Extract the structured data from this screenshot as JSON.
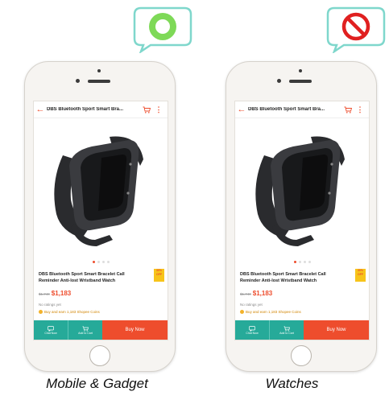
{
  "panels": [
    {
      "id": "left",
      "status": "allowed",
      "app_bar": {
        "title": "DBS Bluetooth Sport Smart Bra..."
      },
      "product": {
        "name": "DBS Bluetooth Sport Smart Bracelet Call Reminder Anti-lost Wristband Watch",
        "old_price": "$1,740",
        "price": "$1,183",
        "ratings": "No ratings yet",
        "coins": "Buy and earn 1,183 Shopee Coins",
        "badge": "30% OFF"
      },
      "actions": {
        "chat": "Chat Now",
        "cart": "Add to Cart",
        "buy": "Buy Now"
      },
      "caption": "Mobile & Gadget"
    },
    {
      "id": "right",
      "status": "prohibited",
      "app_bar": {
        "title": "DBS Bluetooth Sport Smart Bra..."
      },
      "product": {
        "name": "DBS Bluetooth Sport Smart Bracelet Call Reminder Anti-lost Wristband Watch",
        "old_price": "$1,740",
        "price": "$1,183",
        "ratings": "No ratings yet",
        "coins": "Buy and earn 1,183 Shopee Coins",
        "badge": "30% OFF"
      },
      "actions": {
        "chat": "Chat Now",
        "cart": "Add to Cart",
        "buy": "Buy Now"
      },
      "caption": "Watches"
    }
  ],
  "colors": {
    "brand": "#ee4d2d",
    "chat": "#26aa99",
    "ok": "#7ed957",
    "ok_ring": "#3fb949",
    "no": "#e02020",
    "bubble_border": "#7fd7cc"
  },
  "icons": [
    "green-circle-icon",
    "prohibited-icon",
    "back-arrow-icon",
    "cart-icon",
    "more-icon",
    "chat-icon",
    "add-to-cart-icon",
    "coin-icon"
  ]
}
